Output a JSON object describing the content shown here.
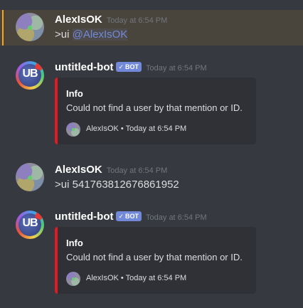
{
  "messages": [
    {
      "author": "AlexIsOK",
      "timestamp": "Today at 6:54 PM",
      "text_prefix": ">ui ",
      "mention": "@AlexIsOK",
      "highlighted": true
    },
    {
      "author": "untitled-bot",
      "bot_tag": "BOT",
      "bot_check": "✓",
      "timestamp": "Today at 6:54 PM",
      "avatar_text": "UB",
      "embed": {
        "title": "Info",
        "description": "Could not find a user by that mention or ID.",
        "footer": "AlexIsOK • Today at 6:54 PM",
        "color": "#e01b24"
      }
    },
    {
      "author": "AlexIsOK",
      "timestamp": "Today at 6:54 PM",
      "text": ">ui 541763812676861952"
    },
    {
      "author": "untitled-bot",
      "bot_tag": "BOT",
      "bot_check": "✓",
      "timestamp": "Today at 6:54 PM",
      "avatar_text": "UB",
      "embed": {
        "title": "Info",
        "description": "Could not find a user by that mention or ID.",
        "footer": "AlexIsOK • Today at 6:54 PM",
        "color": "#e01b24"
      }
    }
  ],
  "colors": {
    "background": "#36393f",
    "highlight": "#49443c",
    "mention_bar": "#faa61a",
    "bot_tag": "#7289da",
    "embed_bg": "#2f3136"
  }
}
